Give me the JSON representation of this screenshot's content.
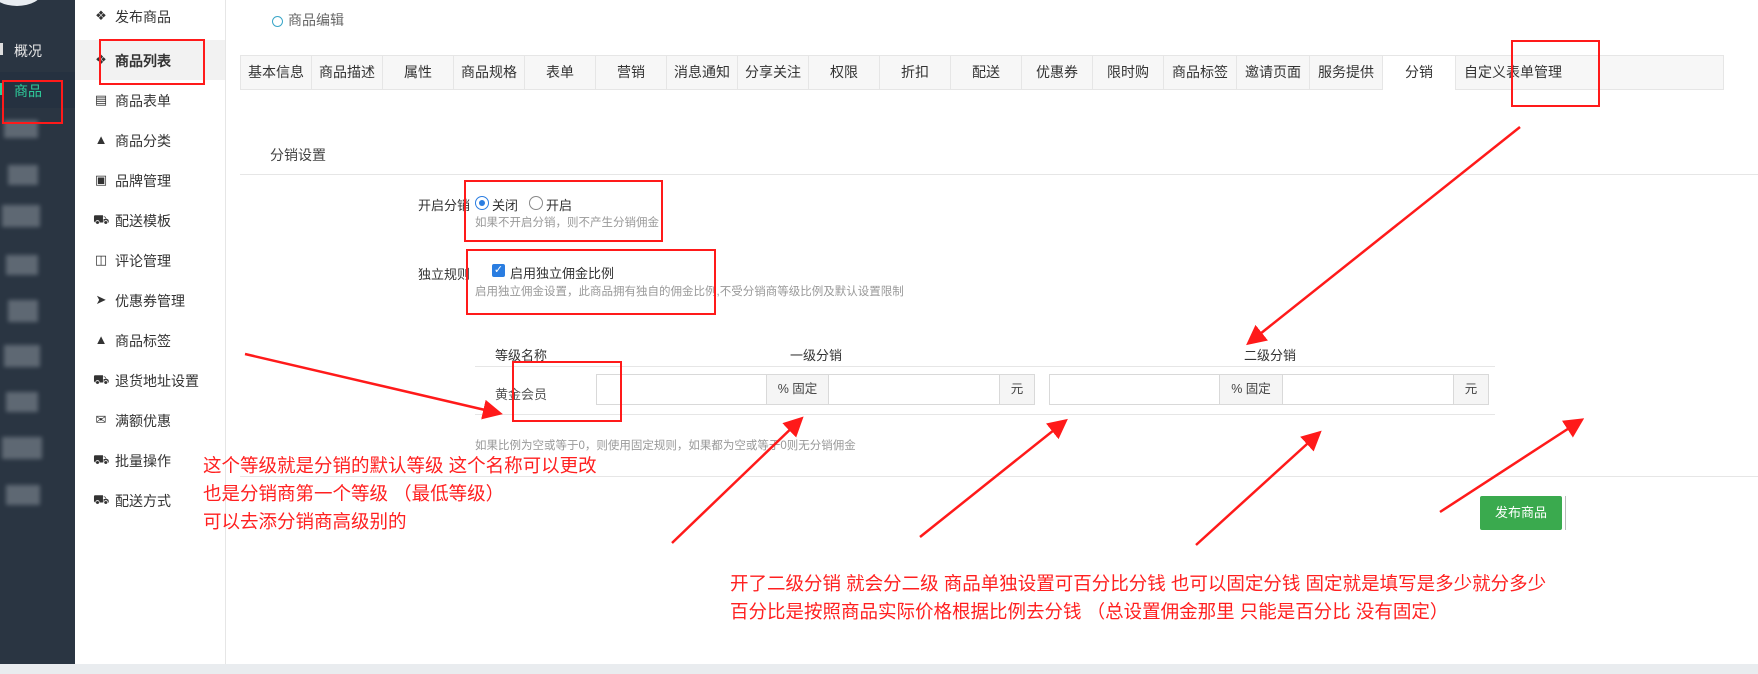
{
  "rail": {
    "items": [
      {
        "label": "概况"
      },
      {
        "label": "商品"
      }
    ]
  },
  "sidebar": {
    "items": [
      {
        "label": "发布商品",
        "icon": "cubes-icon"
      },
      {
        "label": "商品列表",
        "icon": "cubes-icon"
      },
      {
        "label": "商品表单",
        "icon": "file-excel-icon"
      },
      {
        "label": "商品分类",
        "icon": "sitemap-icon"
      },
      {
        "label": "品牌管理",
        "icon": "briefcase-icon"
      },
      {
        "label": "配送模板",
        "icon": "truck-icon"
      },
      {
        "label": "评论管理",
        "icon": "columns-icon"
      },
      {
        "label": "优惠券管理",
        "icon": "tags-icon"
      },
      {
        "label": "商品标签",
        "icon": "sitemap-icon"
      },
      {
        "label": "退货地址设置",
        "icon": "truck-icon"
      },
      {
        "label": "满额优惠",
        "icon": "gift-icon"
      },
      {
        "label": "批量操作",
        "icon": "truck-icon"
      },
      {
        "label": "配送方式",
        "icon": "truck-icon"
      }
    ]
  },
  "breadcrumb": "商品编辑",
  "tabs": [
    "基本信息",
    "商品描述",
    "属性",
    "商品规格",
    "表单",
    "营销",
    "消息通知",
    "分享关注",
    "权限",
    "折扣",
    "配送",
    "优惠券",
    "限时购",
    "商品标签",
    "邀请页面",
    "服务提供",
    "分销",
    "自定义表单管理"
  ],
  "active_tab": "分销",
  "section_title": "分销设置",
  "distribution": {
    "label": "开启分销",
    "options": [
      "关闭",
      "开启"
    ],
    "selected": "关闭",
    "hint": "如果不开启分销，则不产生分销佣金"
  },
  "independent": {
    "label": "独立规则",
    "checkbox_label": "启用独立佣金比例",
    "checked": true,
    "hint": "启用独立佣金设置，此商品拥有独自的佣金比例,不受分销商等级比例及默认设置限制"
  },
  "commission_table": {
    "headers": [
      "等级名称",
      "一级分销",
      "二级分销"
    ],
    "row_label": "黄金会员",
    "percent_addon": "% 固定",
    "yuan_addon": "元",
    "footnote": "如果比例为空或等于0，则使用固定规则，如果都为空或等于0则无分销佣金"
  },
  "publish_button": "发布商品",
  "annotations": {
    "left": [
      "这个等级就是分销的默认等级 这个名称可以更改",
      "也是分销商第一个等级 （最低等级）",
      "可以去添分销商高级别的"
    ],
    "bottom": [
      "开了二级分销  就会分二级   商品单独设置可百分比分钱 也可以固定分钱       固定就是填写是多少就分多少",
      "百分比是按照商品实际价格根据比例去分钱    （总设置佣金那里 只能是百分比 没有固定）"
    ]
  },
  "colors": {
    "rail_bg": "#2a3542",
    "active_green": "#2ecc9b",
    "annotation_red": "#ff2020",
    "publish_green": "#3aaa4e",
    "radio_blue": "#2a7de1"
  }
}
